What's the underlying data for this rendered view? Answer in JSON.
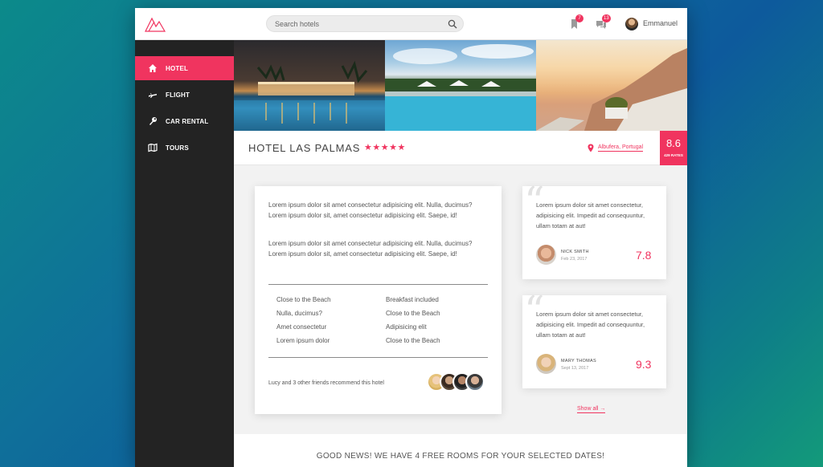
{
  "header": {
    "search_placeholder": "Search hotels",
    "bookmark_badge": "7",
    "messages_badge": "13",
    "user_name": "Emmanuel"
  },
  "sidebar": {
    "items": [
      {
        "label": "HOTEL",
        "icon": "home-icon",
        "active": true
      },
      {
        "label": "FLIGHT",
        "icon": "plane-icon",
        "active": false
      },
      {
        "label": "CAR RENTAL",
        "icon": "wrench-icon",
        "active": false
      },
      {
        "label": "TOURS",
        "icon": "map-icon",
        "active": false
      }
    ]
  },
  "hotel": {
    "name": "HOTEL LAS PALMAS",
    "stars": "★★★★★",
    "location": "Albufera, Portugal",
    "rating": "8.6",
    "rates_count": "429 RATES"
  },
  "description": {
    "paragraphs": [
      "Lorem ipsum dolor sit amet consectetur adipisicing elit. Nulla, ducimus?Lorem ipsum dolor sit, amet consectetur adipisicing elit. Saepe, id!",
      "Lorem ipsum dolor sit amet consectetur adipisicing elit. Nulla, ducimus?Lorem ipsum dolor sit, amet consectetur adipisicing elit. Saepe, id!"
    ],
    "features_left": [
      "Close to the Beach",
      "Nulla, ducimus?",
      "Amet consectetur",
      "Lorem ipsum dolor"
    ],
    "features_right": [
      "Breakfast included",
      "Close to the Beach",
      "Adipisicing elit",
      "Close to the Beach"
    ],
    "recommend_text": "Lucy and 3 other friends recommend this hotel"
  },
  "reviews": [
    {
      "text": "Lorem ipsum dolor sit amet consectetur, adipisicing elit. Impedit ad consequuntur, ullam totam at aut!",
      "name": "NICK SMITH",
      "date": "Feb 23, 2017",
      "score": "7.8"
    },
    {
      "text": "Lorem ipsum dolor sit amet consectetur, adipisicing elit. Impedit ad consequuntur, ullam totam at aut!",
      "name": "MARY THOMAS",
      "date": "Sept 13, 2017",
      "score": "9.3"
    }
  ],
  "show_all_label": "Show all →",
  "good_news": "GOOD NEWS! WE HAVE 4 FREE ROOMS FOR YOUR SELECTED DATES!",
  "colors": {
    "accent": "#f0345f",
    "sidebar": "#232323",
    "content_bg": "#f2f2f2"
  }
}
